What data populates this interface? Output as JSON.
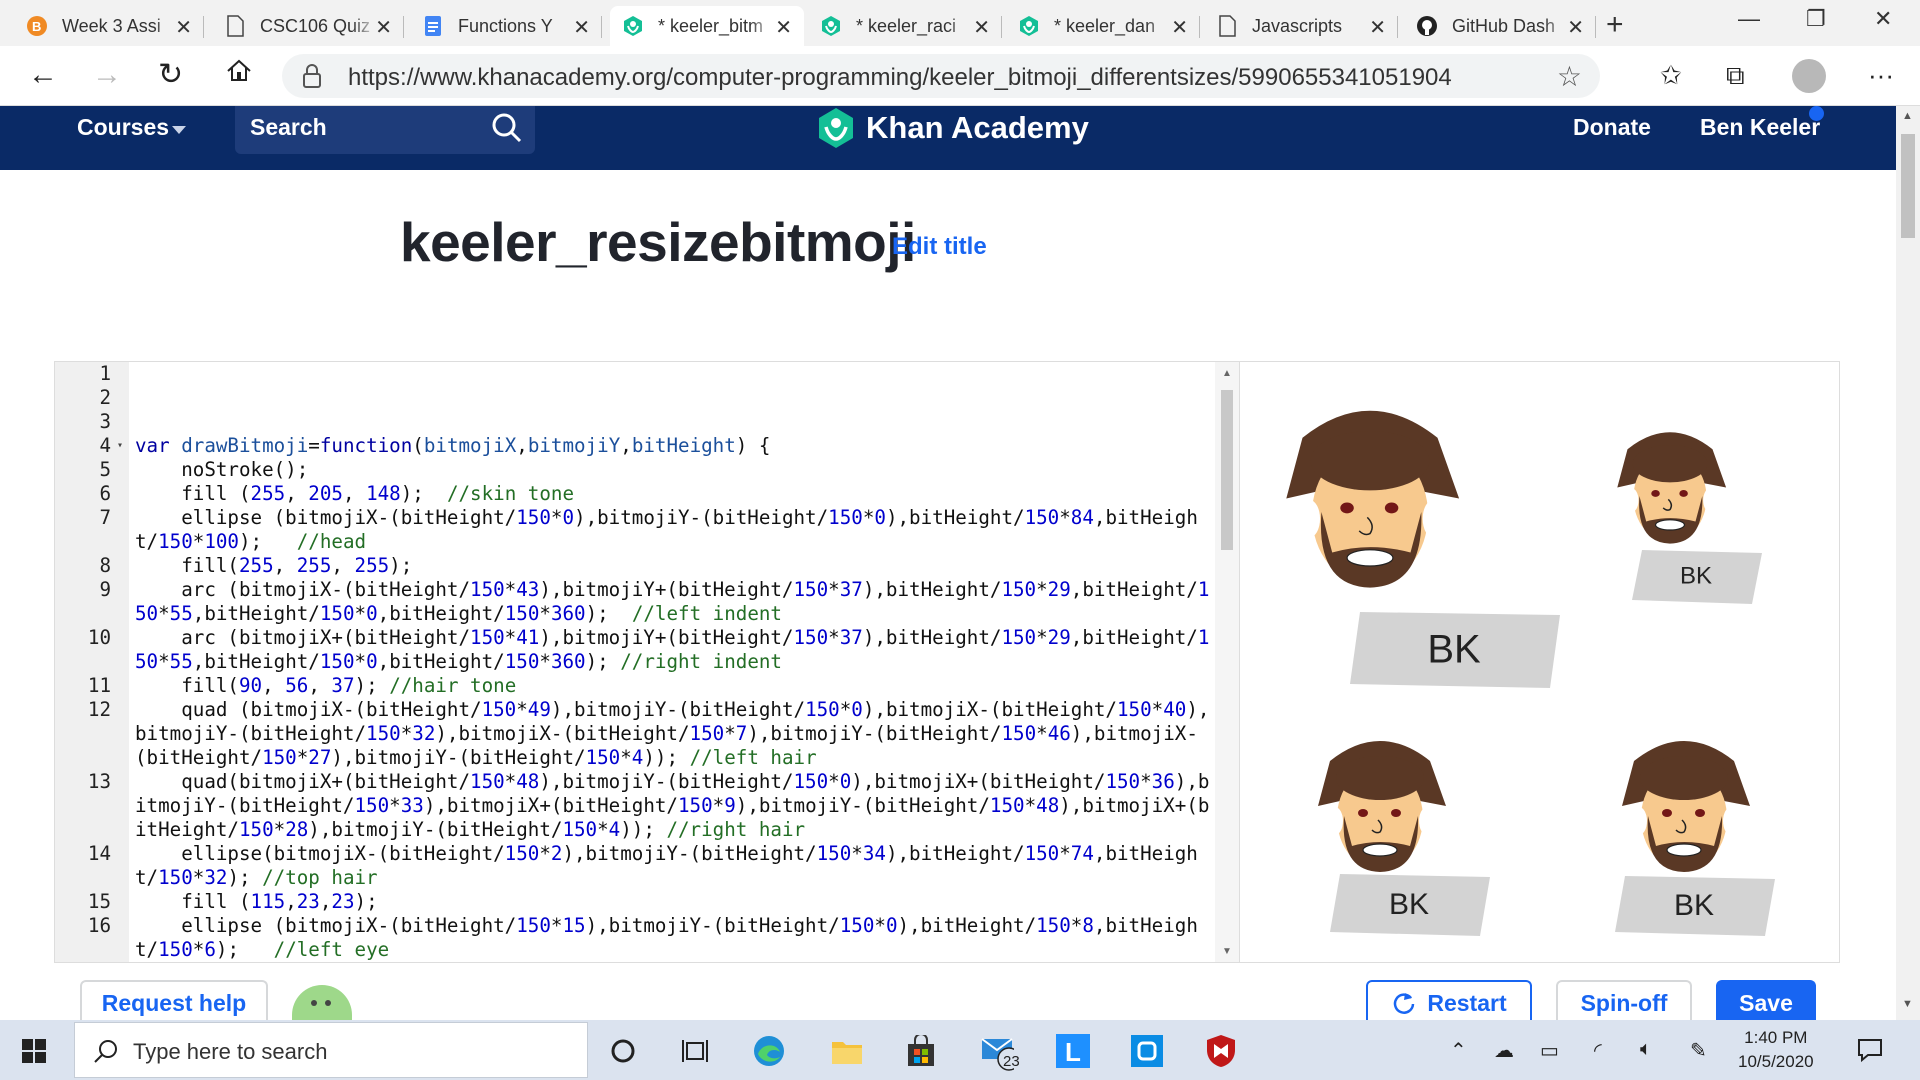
{
  "browser": {
    "tabs": [
      {
        "label": "Week 3 Assi",
        "icon": "b-icon",
        "active": false
      },
      {
        "label": "CSC106 Quiz",
        "icon": "document-icon",
        "active": false
      },
      {
        "label": "Functions Y",
        "icon": "docs-icon",
        "active": false
      },
      {
        "label": "* keeler_bitm",
        "icon": "khan-icon",
        "active": true
      },
      {
        "label": "* keeler_raci",
        "icon": "khan-icon",
        "active": false
      },
      {
        "label": "* keeler_dan",
        "icon": "khan-icon",
        "active": false
      },
      {
        "label": "Javascripts",
        "icon": "document-icon",
        "active": false
      },
      {
        "label": "GitHub Dash",
        "icon": "github-icon",
        "active": false
      }
    ],
    "url": "https://www.khanacademy.org/computer-programming/keeler_bitmoji_differentsizes/5990655341051904"
  },
  "header": {
    "courses": "Courses",
    "search": "Search",
    "brand": "Khan Academy",
    "donate": "Donate",
    "user": "Ben Keeler"
  },
  "page": {
    "title": "keeler_resizebitmoji",
    "edit_title": "Edit title"
  },
  "code": [
    {
      "n": "1",
      "html": ""
    },
    {
      "n": "2",
      "html": ""
    },
    {
      "n": "3",
      "html": ""
    },
    {
      "n": "4",
      "fold": true,
      "html": "<span class=\"kw\">var</span> <span class=\"vr\">drawBitmoji</span>=<span class=\"kw\">function</span>(<span class=\"vr\">bitmojiX</span>,<span class=\"vr\">bitmojiY</span>,<span class=\"vr\">bitHeight</span>) {"
    },
    {
      "n": "5",
      "html": "    noStroke();"
    },
    {
      "n": "6",
      "html": "    fill (<span class=\"nm\">255</span>, <span class=\"nm\">205</span>, <span class=\"nm\">148</span>);  <span class=\"cm\">//skin tone</span>"
    },
    {
      "n": "7",
      "html": "    ellipse (bitmojiX-(bitHeight/<span class=\"nm\">150</span>*<span class=\"nm\">0</span>),bitmojiY-(bitHeight/<span class=\"nm\">150</span>*<span class=\"nm\">0</span>),bitHeight/<span class=\"nm\">150</span>*<span class=\"nm\">84</span>,bitHeight/<span class=\"nm\">150</span>*<span class=\"nm\">100</span>);   <span class=\"cm\">//head</span>"
    },
    {
      "n": "8",
      "html": "    fill(<span class=\"nm\">255</span>, <span class=\"nm\">255</span>, <span class=\"nm\">255</span>);"
    },
    {
      "n": "9",
      "html": "    arc (bitmojiX-(bitHeight/<span class=\"nm\">150</span>*<span class=\"nm\">43</span>),bitmojiY+(bitHeight/<span class=\"nm\">150</span>*<span class=\"nm\">37</span>),bitHeight/<span class=\"nm\">150</span>*<span class=\"nm\">29</span>,bitHeight/<span class=\"nm\">150</span>*<span class=\"nm\">55</span>,bitHeight/<span class=\"nm\">150</span>*<span class=\"nm\">0</span>,bitHeight/<span class=\"nm\">150</span>*<span class=\"nm\">360</span>);  <span class=\"cm\">//left indent</span>"
    },
    {
      "n": "10",
      "html": "    arc (bitmojiX+(bitHeight/<span class=\"nm\">150</span>*<span class=\"nm\">41</span>),bitmojiY+(bitHeight/<span class=\"nm\">150</span>*<span class=\"nm\">37</span>),bitHeight/<span class=\"nm\">150</span>*<span class=\"nm\">29</span>,bitHeight/<span class=\"nm\">150</span>*<span class=\"nm\">55</span>,bitHeight/<span class=\"nm\">150</span>*<span class=\"nm\">0</span>,bitHeight/<span class=\"nm\">150</span>*<span class=\"nm\">360</span>); <span class=\"cm\">//right indent</span>"
    },
    {
      "n": "11",
      "html": "    fill(<span class=\"nm\">90</span>, <span class=\"nm\">56</span>, <span class=\"nm\">37</span>); <span class=\"cm\">//hair tone</span>"
    },
    {
      "n": "12",
      "html": "    quad (bitmojiX-(bitHeight/<span class=\"nm\">150</span>*<span class=\"nm\">49</span>),bitmojiY-(bitHeight/<span class=\"nm\">150</span>*<span class=\"nm\">0</span>),bitmojiX-(bitHeight/<span class=\"nm\">150</span>*<span class=\"nm\">40</span>),bitmojiY-(bitHeight/<span class=\"nm\">150</span>*<span class=\"nm\">32</span>),bitmojiX-(bitHeight/<span class=\"nm\">150</span>*<span class=\"nm\">7</span>),bitmojiY-(bitHeight/<span class=\"nm\">150</span>*<span class=\"nm\">46</span>),bitmojiX-(bitHeight/<span class=\"nm\">150</span>*<span class=\"nm\">27</span>),bitmojiY-(bitHeight/<span class=\"nm\">150</span>*<span class=\"nm\">4</span>)); <span class=\"cm\">//left hair</span>"
    },
    {
      "n": "13",
      "html": "    quad(bitmojiX+(bitHeight/<span class=\"nm\">150</span>*<span class=\"nm\">48</span>),bitmojiY-(bitHeight/<span class=\"nm\">150</span>*<span class=\"nm\">0</span>),bitmojiX+(bitHeight/<span class=\"nm\">150</span>*<span class=\"nm\">36</span>),bitmojiY-(bitHeight/<span class=\"nm\">150</span>*<span class=\"nm\">33</span>),bitmojiX+(bitHeight/<span class=\"nm\">150</span>*<span class=\"nm\">9</span>),bitmojiY-(bitHeight/<span class=\"nm\">150</span>*<span class=\"nm\">48</span>),bitmojiX+(bitHeight/<span class=\"nm\">150</span>*<span class=\"nm\">28</span>),bitmojiY-(bitHeight/<span class=\"nm\">150</span>*<span class=\"nm\">4</span>)); <span class=\"cm\">//right hair</span>"
    },
    {
      "n": "14",
      "html": "    ellipse(bitmojiX-(bitHeight/<span class=\"nm\">150</span>*<span class=\"nm\">2</span>),bitmojiY-(bitHeight/<span class=\"nm\">150</span>*<span class=\"nm\">34</span>),bitHeight/<span class=\"nm\">150</span>*<span class=\"nm\">74</span>,bitHeight/<span class=\"nm\">150</span>*<span class=\"nm\">32</span>); <span class=\"cm\">//top hair</span>"
    },
    {
      "n": "15",
      "html": "    fill (<span class=\"nm\">115</span>,<span class=\"nm\">23</span>,<span class=\"nm\">23</span>);"
    },
    {
      "n": "16",
      "html": "    ellipse (bitmojiX-(bitHeight/<span class=\"nm\">150</span>*<span class=\"nm\">15</span>),bitmojiY-(bitHeight/<span class=\"nm\">150</span>*<span class=\"nm\">0</span>),bitHeight/<span class=\"nm\">150</span>*<span class=\"nm\">8</span>,bitHeight/<span class=\"nm\">150</span>*<span class=\"nm\">6</span>);   <span class=\"cm\">//left eye</span>"
    }
  ],
  "canvas": {
    "label": "BK"
  },
  "buttons": {
    "request_help": "Request help",
    "restart": "Restart",
    "spinoff": "Spin-off",
    "save": "Save"
  },
  "taskbar": {
    "search_placeholder": "Type here to search",
    "time": "1:40 PM",
    "date": "10/5/2020",
    "mail_badge": "23"
  },
  "colors": {
    "ka_navy": "#0a2a66",
    "ka_blue": "#1865f2",
    "skin": "#f7c98e",
    "hair": "#5a3825",
    "eye": "#731717"
  }
}
